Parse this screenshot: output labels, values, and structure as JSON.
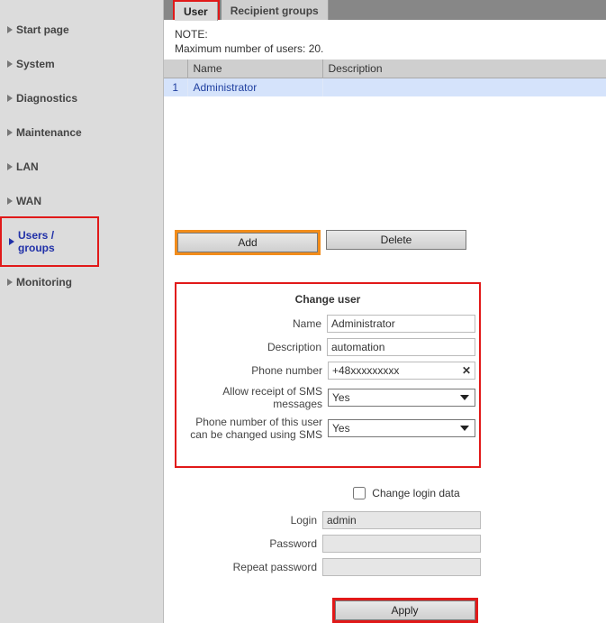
{
  "sidebar": {
    "items": [
      {
        "label": "Start page"
      },
      {
        "label": "System"
      },
      {
        "label": "Diagnostics"
      },
      {
        "label": "Maintenance"
      },
      {
        "label": "LAN"
      },
      {
        "label": "WAN"
      },
      {
        "label": "Users / groups"
      },
      {
        "label": "Monitoring"
      }
    ],
    "active_index": 6
  },
  "tabs": {
    "items": [
      {
        "label": "User"
      },
      {
        "label": "Recipient groups"
      }
    ],
    "active_index": 0
  },
  "note": {
    "line1": "NOTE:",
    "line2": "Maximum number of users: 20."
  },
  "table": {
    "headers": {
      "num": "",
      "name": "Name",
      "desc": "Description"
    },
    "rows": [
      {
        "num": "1",
        "name": "Administrator",
        "desc": ""
      }
    ]
  },
  "buttons": {
    "add": "Add",
    "delete": "Delete",
    "apply": "Apply"
  },
  "change_user": {
    "title": "Change user",
    "labels": {
      "name": "Name",
      "desc": "Description",
      "phone": "Phone number",
      "allow_sms": "Allow receipt of SMS messages",
      "phone_sms": "Phone number of this user can be changed using SMS"
    },
    "values": {
      "name": "Administrator",
      "desc": "automation",
      "phone": "+48xxxxxxxxx",
      "allow_sms": "Yes",
      "phone_sms": "Yes"
    }
  },
  "login_section": {
    "checkbox_label": "Change login data",
    "labels": {
      "login": "Login",
      "password": "Password",
      "repeat": "Repeat password"
    },
    "values": {
      "login": "admin",
      "password": "",
      "repeat": ""
    }
  }
}
